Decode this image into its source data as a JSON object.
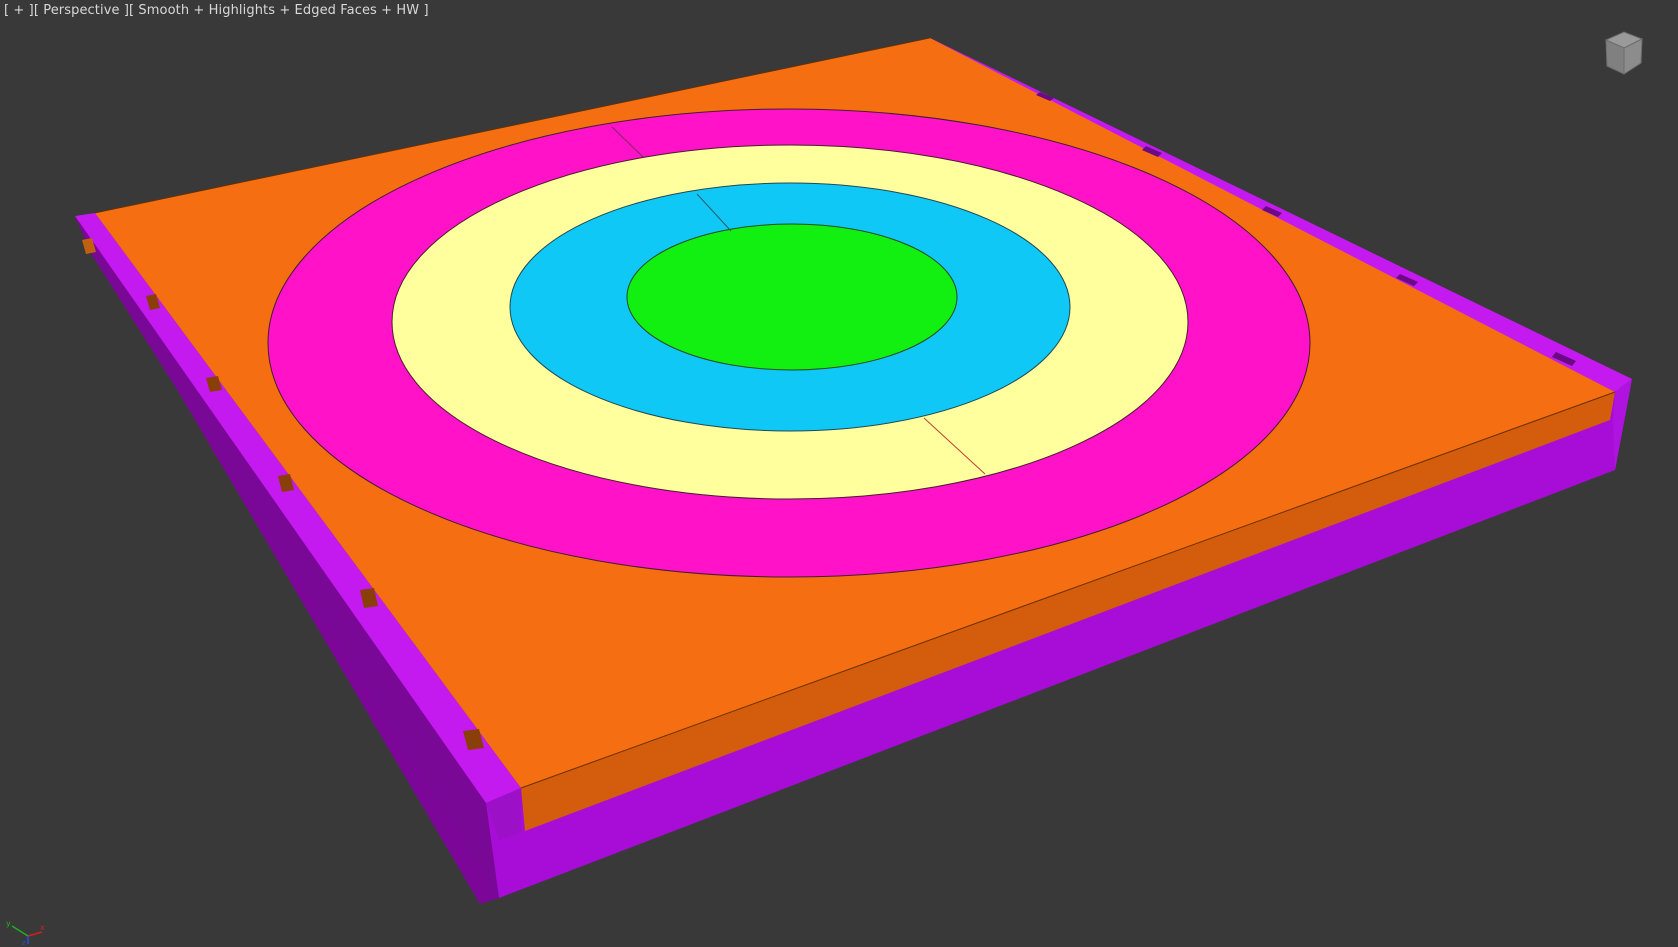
{
  "viewport": {
    "label": {
      "plus": "[ + ]",
      "view": "[ Perspective ]",
      "shading": "[ Smooth + Highlights + Edged Faces + HW ]"
    },
    "viewcube_icon": "viewcube-icon",
    "axis_icon": "axis-tripod-icon",
    "axis_labels": {
      "x": "x",
      "y": "y",
      "z": "z"
    }
  },
  "scene": {
    "background_color": "#393939",
    "objects": [
      {
        "name": "base-frame",
        "color": "#b012e0"
      },
      {
        "name": "top-slab",
        "color": "#f56f12"
      },
      {
        "name": "outer-ring",
        "color": "#ff12c8"
      },
      {
        "name": "second-ring",
        "color": "#ffff9e"
      },
      {
        "name": "third-ring",
        "color": "#10c8f5"
      },
      {
        "name": "center-disc",
        "color": "#12f012"
      }
    ]
  }
}
